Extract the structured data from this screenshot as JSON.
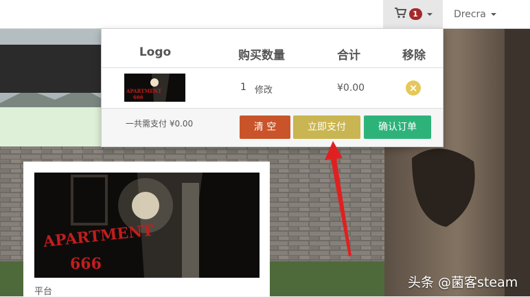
{
  "navbar": {
    "cart_count": "1",
    "user_name": "Drecra"
  },
  "cart": {
    "headers": {
      "logo": "Logo",
      "qty": "购买数量",
      "total": "合计",
      "remove": "移除"
    },
    "items": [
      {
        "game_title": "APARTMENT 666",
        "quantity": "1",
        "edit_label": "修改",
        "total": "¥0.00"
      }
    ],
    "total_payment": "一共需支付 ¥0.00",
    "buttons": {
      "clear": "清 空",
      "pay_now": "立即支付",
      "confirm_order": "确认订单"
    },
    "colors": {
      "clear": "#c9542a",
      "pay_now": "#c9b551",
      "confirm_order": "#2db37a"
    }
  },
  "product": {
    "title_art": "APARTMENT 666",
    "platform_label": "平台"
  },
  "watermark": "头条 @菌客steam",
  "icons": [
    "cart-icon",
    "remove-icon",
    "caret-down-icon",
    "arrow-annotation"
  ]
}
